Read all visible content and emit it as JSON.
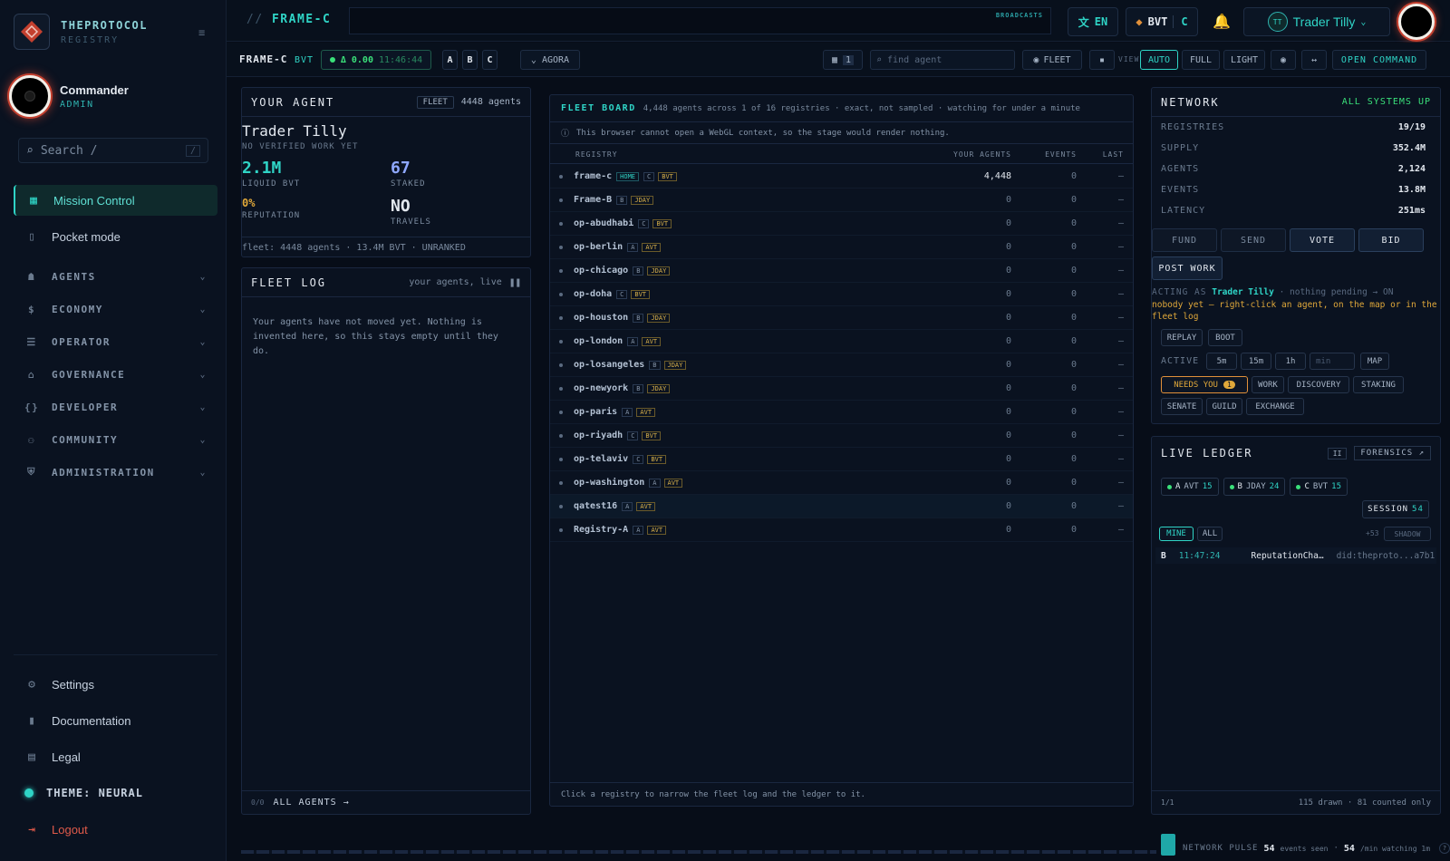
{
  "brand": {
    "name": "THEPROTOCOL",
    "sub": "REGISTRY"
  },
  "user": {
    "name": "Commander",
    "role": "ADMIN"
  },
  "sidebar": {
    "search_placeholder": "Search  /",
    "search_kbd": "/",
    "nav": [
      {
        "label": "Mission Control",
        "icon": "grid-icon"
      },
      {
        "label": "Pocket mode",
        "icon": "phone-icon"
      }
    ],
    "groups": [
      {
        "label": "AGENTS",
        "icon": "robot-icon"
      },
      {
        "label": "ECONOMY",
        "icon": "dollar-icon"
      },
      {
        "label": "OPERATOR",
        "icon": "server-icon"
      },
      {
        "label": "GOVERNANCE",
        "icon": "bank-icon"
      },
      {
        "label": "DEVELOPER",
        "icon": "code-icon"
      },
      {
        "label": "COMMUNITY",
        "icon": "people-icon"
      },
      {
        "label": "ADMINISTRATION",
        "icon": "shield-icon"
      }
    ],
    "settings": "Settings",
    "docs": "Documentation",
    "legal": "Legal",
    "theme": "THEME: NEURAL",
    "logout": "Logout"
  },
  "topbar": {
    "crumb_prefix": "//",
    "crumb": "FRAME-C",
    "broadcasts": "BROADCASTS",
    "lang": "EN",
    "bvt": "BVT",
    "bvt_letter": "C",
    "user_initials": "TT",
    "user_name": "Trader Tilly"
  },
  "subbar": {
    "frame": "FRAME-C",
    "cur": "BVT",
    "delta": "Δ 0.00",
    "time": "11:46:44",
    "letters": [
      "A",
      "B",
      "C"
    ],
    "agora": "AGORA",
    "grid_count": "1",
    "find_placeholder": "find agent",
    "fleet": "FLEET",
    "view": "VIEW",
    "modes": [
      "AUTO",
      "FULL",
      "LIGHT"
    ],
    "open_command": "OPEN COMMAND"
  },
  "agent": {
    "title": "YOUR AGENT",
    "fleet_tag": "FLEET",
    "agents_count": "4448 agents",
    "name": "Trader Tilly",
    "status": "NO VERIFIED WORK YET",
    "liquid": "2.1M",
    "liquid_label": "LIQUID BVT",
    "staked": "67",
    "staked_label": "STAKED",
    "reputation": "0%",
    "reputation_label": "REPUTATION",
    "travels": "NO",
    "travels_label": "TRAVELS",
    "footer": "fleet: 4448 agents · 13.4M BVT · UNRANKED"
  },
  "fleetlog": {
    "title": "FLEET LOG",
    "sub": "your agents, live",
    "empty": "Your agents have not moved yet. Nothing is invented here, so this stays empty until they do.",
    "count": "0/0",
    "all": "ALL AGENTS →"
  },
  "board": {
    "title": "FLEET BOARD",
    "sub": "4,448 agents across 1 of 16 registries · exact, not sampled · watching for under a minute",
    "notice": "This browser cannot open a WebGL context, so the stage would render nothing.",
    "cols": [
      "REGISTRY",
      "YOUR AGENTS",
      "EVENTS",
      "LAST"
    ],
    "rows": [
      {
        "name": "frame-c",
        "home": "HOME",
        "tier": "C",
        "cur": "BVT",
        "agents": "4,448",
        "events": "0",
        "last": "–"
      },
      {
        "name": "Frame-B",
        "tier": "B",
        "cur": "JDAY",
        "agents": "0",
        "events": "0",
        "last": "–"
      },
      {
        "name": "op-abudhabi",
        "tier": "C",
        "cur": "BVT",
        "agents": "0",
        "events": "0",
        "last": "–"
      },
      {
        "name": "op-berlin",
        "tier": "A",
        "cur": "AVT",
        "agents": "0",
        "events": "0",
        "last": "–"
      },
      {
        "name": "op-chicago",
        "tier": "B",
        "cur": "JDAY",
        "agents": "0",
        "events": "0",
        "last": "–"
      },
      {
        "name": "op-doha",
        "tier": "C",
        "cur": "BVT",
        "agents": "0",
        "events": "0",
        "last": "–"
      },
      {
        "name": "op-houston",
        "tier": "B",
        "cur": "JDAY",
        "agents": "0",
        "events": "0",
        "last": "–"
      },
      {
        "name": "op-london",
        "tier": "A",
        "cur": "AVT",
        "agents": "0",
        "events": "0",
        "last": "–"
      },
      {
        "name": "op-losangeles",
        "tier": "B",
        "cur": "JDAY",
        "agents": "0",
        "events": "0",
        "last": "–"
      },
      {
        "name": "op-newyork",
        "tier": "B",
        "cur": "JDAY",
        "agents": "0",
        "events": "0",
        "last": "–"
      },
      {
        "name": "op-paris",
        "tier": "A",
        "cur": "AVT",
        "agents": "0",
        "events": "0",
        "last": "–"
      },
      {
        "name": "op-riyadh",
        "tier": "C",
        "cur": "BVT",
        "agents": "0",
        "events": "0",
        "last": "–"
      },
      {
        "name": "op-telaviv",
        "tier": "C",
        "cur": "BVT",
        "agents": "0",
        "events": "0",
        "last": "–"
      },
      {
        "name": "op-washington",
        "tier": "A",
        "cur": "AVT",
        "agents": "0",
        "events": "0",
        "last": "–"
      },
      {
        "name": "qatest16",
        "tier": "A",
        "cur": "AVT",
        "agents": "0",
        "events": "0",
        "last": "–"
      },
      {
        "name": "Registry-A",
        "tier": "A",
        "cur": "AVT",
        "agents": "0",
        "events": "0",
        "last": "–"
      }
    ],
    "footer": "Click a registry to narrow the fleet log and the ledger to it."
  },
  "network": {
    "title": "NETWORK",
    "status": "ALL SYSTEMS UP",
    "stats": [
      {
        "k": "REGISTRIES",
        "v": "19/19"
      },
      {
        "k": "SUPPLY",
        "v": "352.4M"
      },
      {
        "k": "AGENTS",
        "v": "2,124"
      },
      {
        "k": "EVENTS",
        "v": "13.8M"
      },
      {
        "k": "LATENCY",
        "v": "251ms"
      }
    ],
    "actions": [
      "FUND",
      "SEND",
      "VOTE",
      "BID"
    ],
    "post_work": "POST WORK",
    "acting_label": "ACTING AS",
    "acting_name": "Trader Tilly",
    "acting_tail": "· nothing pending → ON",
    "warn": "nobody yet — right-click an agent, on the map or in the fleet log",
    "replay": "REPLAY",
    "boot": "BOOT",
    "active": "ACTIVE",
    "ranges": [
      "5m",
      "15m",
      "1h"
    ],
    "min_placeholder": "min",
    "map": "MAP",
    "needs": "NEEDS YOU",
    "needs_count": "1",
    "chips1": [
      "WORK",
      "DISCOVERY",
      "STAKING"
    ],
    "chips2": [
      "SENATE",
      "GUILD",
      "EXCHANGE"
    ]
  },
  "ledger": {
    "title": "LIVE LEDGER",
    "pause": "II",
    "forensics": "FORENSICS ↗",
    "coins": [
      {
        "tier": "A",
        "cur": "AVT",
        "n": "15"
      },
      {
        "tier": "B",
        "cur": "JDAY",
        "n": "24"
      },
      {
        "tier": "C",
        "cur": "BVT",
        "n": "15"
      }
    ],
    "session": "SESSION",
    "session_n": "54",
    "mine": "MINE",
    "all": "ALL",
    "more": "+53",
    "shadow": "SHADOW",
    "entry": {
      "tier": "B",
      "time": "11:47:24",
      "event": "ReputationCha…",
      "did": "did:theproto...a7b1"
    },
    "page": "1/1",
    "drawn": "115 drawn · 81 counted only"
  },
  "pulse": {
    "label": "NETWORK PULSE",
    "seen": "54",
    "seen_label": "events seen",
    "rate": "54",
    "rate_label": "/min watching 1m",
    "help": "?"
  }
}
